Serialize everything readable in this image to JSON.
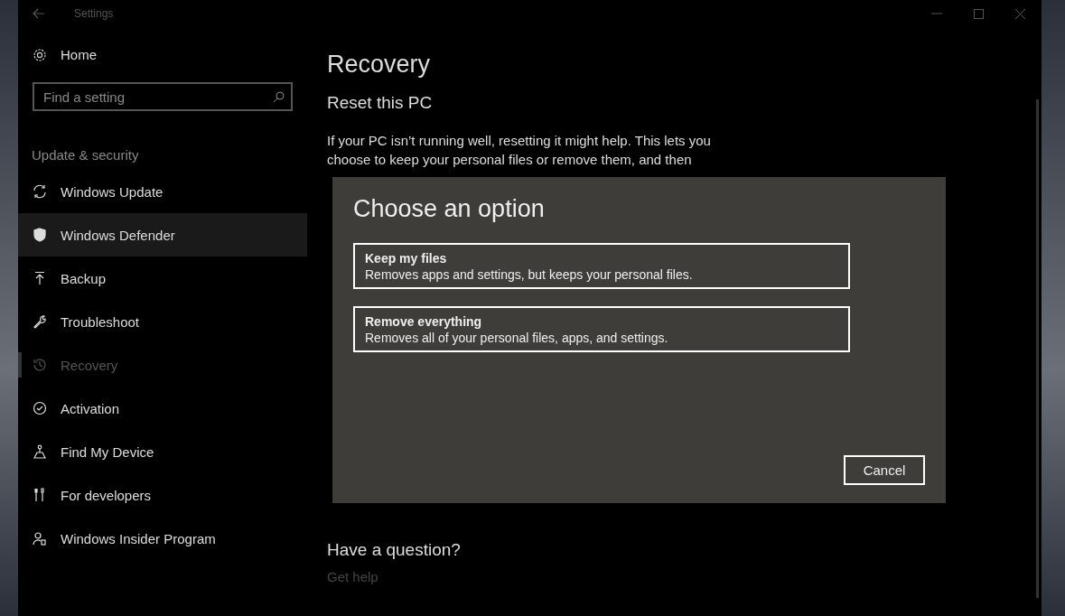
{
  "window": {
    "title": "Settings"
  },
  "sidebar": {
    "home": "Home",
    "search": {
      "placeholder": "Find a setting"
    },
    "section": "Update & security",
    "items": [
      {
        "label": "Windows Update",
        "kind": "refresh",
        "selected": false,
        "hovered": false
      },
      {
        "label": "Windows Defender",
        "kind": "shield",
        "selected": false,
        "hovered": true
      },
      {
        "label": "Backup",
        "kind": "upload",
        "selected": false,
        "hovered": false
      },
      {
        "label": "Troubleshoot",
        "kind": "wrench",
        "selected": false,
        "hovered": false
      },
      {
        "label": "Recovery",
        "kind": "history",
        "selected": true,
        "hovered": false
      },
      {
        "label": "Activation",
        "kind": "check",
        "selected": false,
        "hovered": false
      },
      {
        "label": "Find My Device",
        "kind": "locate",
        "selected": false,
        "hovered": false
      },
      {
        "label": "For developers",
        "kind": "tools",
        "selected": false,
        "hovered": false
      },
      {
        "label": "Windows Insider Program",
        "kind": "insider",
        "selected": false,
        "hovered": false
      }
    ]
  },
  "content": {
    "title": "Recovery",
    "section": "Reset this PC",
    "paragraph": "If your PC isn’t running well, resetting it might help. This lets you choose to keep your personal files or remove them, and then",
    "question": "Have a question?",
    "help_link": "Get help"
  },
  "dialog": {
    "title": "Choose an option",
    "options": [
      {
        "title": "Keep my files",
        "description": "Removes apps and settings, but keeps your personal files."
      },
      {
        "title": "Remove everything",
        "description": "Removes all of your personal files, apps, and settings."
      }
    ],
    "cancel": "Cancel"
  }
}
